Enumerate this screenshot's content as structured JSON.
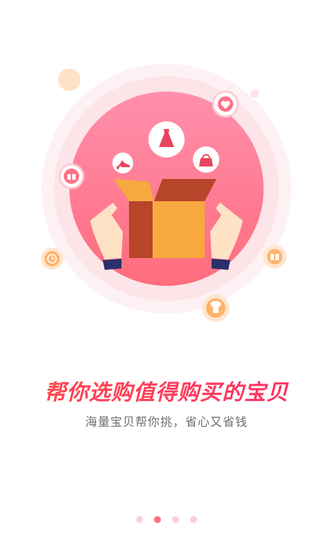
{
  "onboarding": {
    "headline": "帮你选购值得购买的宝贝",
    "subline": "海量宝贝帮你挑，省心又省钱",
    "page_indicator": {
      "total": 4,
      "active_index": 1
    },
    "icons": [
      "heart-tag-icon",
      "gift-icon",
      "clock-icon",
      "gift-box-icon",
      "clothes-icon",
      "dress-icon",
      "high-heel-icon",
      "handbag-icon",
      "open-box-icon"
    ],
    "colors": {
      "accent": "#ff2f55",
      "circle_top": "#ff8fa8",
      "circle_bottom": "#ff6a7a",
      "box": "#f7a93f",
      "box_dark": "#b7452a"
    }
  }
}
